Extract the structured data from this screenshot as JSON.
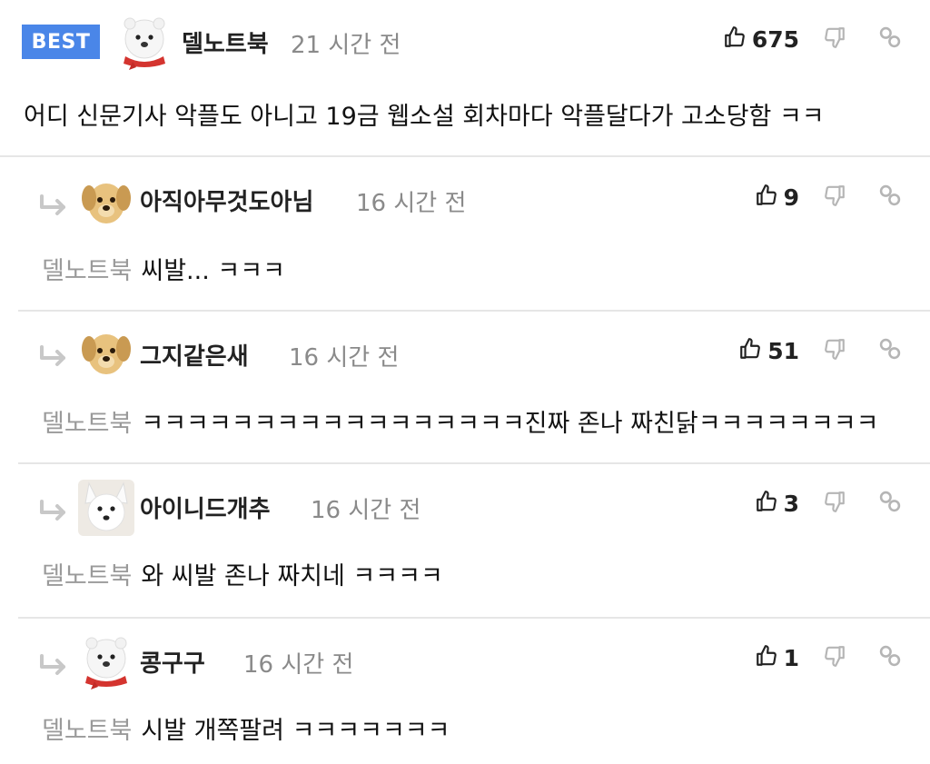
{
  "best_label": "BEST",
  "main_comment": {
    "author": "델노트북",
    "time": "21 시간 전",
    "likes": "675",
    "text": "어디 신문기사 악플도 아니고 19금 웹소설 회차마다 악플달다가 고소당함 ㅋㅋ",
    "avatar": "polar-bear-avatar"
  },
  "replies": [
    {
      "author": "아직아무것도아님",
      "time": "16 시간 전",
      "likes": "9",
      "mention": "델노트북",
      "text": "씨발... ㅋㅋㅋ",
      "avatar": "puppy-avatar"
    },
    {
      "author": "그지같은새",
      "time": "16 시간 전",
      "likes": "51",
      "mention": "델노트북",
      "text": "ㅋㅋㅋㅋㅋㅋㅋㅋㅋㅋㅋㅋㅋㅋㅋㅋㅋ진짜 존나 짜친닭ㅋㅋㅋㅋㅋㅋㅋㅋ",
      "avatar": "puppy-avatar"
    },
    {
      "author": "아이니드개추",
      "time": "16 시간 전",
      "likes": "3",
      "mention": "델노트북",
      "text": "와 씨발 존나 짜치네 ㅋㅋㅋㅋ",
      "avatar": "white-fox-avatar"
    },
    {
      "author": "콩구구",
      "time": "16 시간 전",
      "likes": "1",
      "mention": "델노트북",
      "text": "시발 개쪽팔려 ㅋㅋㅋㅋㅋㅋㅋ",
      "avatar": "polar-bear-avatar"
    }
  ]
}
